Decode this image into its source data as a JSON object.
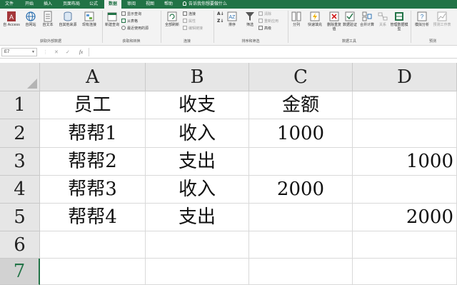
{
  "menu": {
    "tabs": [
      "文件",
      "开始",
      "插入",
      "页面布局",
      "公式",
      "数据",
      "审阅",
      "视图",
      "帮助"
    ],
    "active": "数据",
    "tell_me": "告诉我你想要做什么"
  },
  "ribbon": {
    "get_external_data": {
      "buttons": [
        "自 Access",
        "自网站",
        "自文本",
        "自其他来源",
        "现有连接"
      ],
      "label": "获取外部数据"
    },
    "get_transform": {
      "new_query": "新建查询",
      "items": [
        "显示查询",
        "从表格",
        "最近使用的源"
      ],
      "label": "获取和转换"
    },
    "connections": {
      "refresh_all": "全部刷新",
      "items": [
        "连接",
        "属性",
        "编辑链接"
      ],
      "label": "连接"
    },
    "sort_filter": {
      "sort": "排序",
      "filter": "筛选",
      "items": [
        "清除",
        "重新应用",
        "高级"
      ],
      "label": "排序和筛选"
    },
    "data_tools": {
      "buttons": [
        "分列",
        "快速填充",
        "删除重复值",
        "数据验证",
        "合并计算",
        "关系",
        "管理数据模型"
      ],
      "label": "数据工具"
    },
    "forecast": {
      "buttons": [
        "模拟分析",
        "预测工作表"
      ],
      "label": "预测"
    }
  },
  "formula_bar": {
    "name_box": "E7",
    "cancel": "✕",
    "enter": "✓",
    "fx": "fx",
    "value": ""
  },
  "sheet": {
    "columns": [
      "A",
      "B",
      "C",
      "D"
    ],
    "rows": [
      "1",
      "2",
      "3",
      "4",
      "5",
      "6",
      "7"
    ],
    "selected_row": "7",
    "cells": [
      [
        "员工",
        "收支",
        "金额",
        ""
      ],
      [
        "帮帮1",
        "收入",
        "1000",
        ""
      ],
      [
        "帮帮2",
        "支出",
        "",
        "1000"
      ],
      [
        "帮帮3",
        "收入",
        "2000",
        ""
      ],
      [
        "帮帮4",
        "支出",
        "",
        "2000"
      ],
      [
        "",
        "",
        "",
        ""
      ],
      [
        "",
        "",
        "",
        ""
      ]
    ]
  },
  "colors": {
    "accent": "#217346"
  }
}
